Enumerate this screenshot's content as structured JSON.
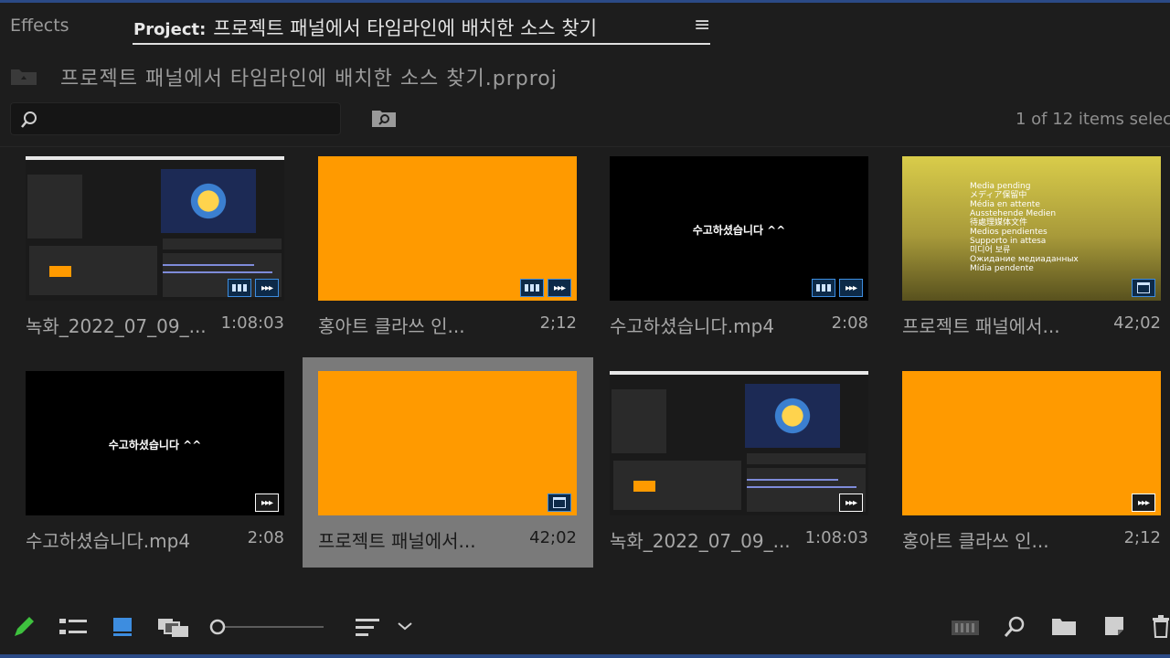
{
  "tabs": {
    "effects_label": "Effects",
    "project_label": "Project:",
    "project_title": "프로젝트 패널에서 타임라인에 배치한 소스 찾기",
    "menu_glyph": "≡"
  },
  "project": {
    "file_name": "프로젝트 패널에서 타임라인에 배치한 소스 찾기.prproj"
  },
  "search": {
    "value": "",
    "placeholder": ""
  },
  "selection_status": "1 of 12 items selec",
  "items": [
    {
      "name": "녹화_2022_07_09_...",
      "duration": "1:08:03",
      "thumb": "screen",
      "badges": [
        "video",
        "audio"
      ],
      "selected": false
    },
    {
      "name": "홍아트 클라쓰 인...",
      "duration": "2;12",
      "thumb": "orange",
      "badges": [
        "video",
        "audio"
      ],
      "selected": false
    },
    {
      "name": "수고하셨습니다.mp4",
      "duration": "2:08",
      "thumb": "black",
      "badges": [
        "video",
        "audio"
      ],
      "thumb_text": "수고하셨습니다 ^^",
      "selected": false
    },
    {
      "name": "프로젝트 패널에서...",
      "duration": "42;02",
      "thumb": "yellow",
      "badges": [
        "sequence"
      ],
      "selected": false,
      "pending_lines": [
        "Media pending",
        "メディア保留中",
        "Média en attente",
        "Ausstehende Medien",
        "待處理媒体文件",
        "Medios pendientes",
        "Supporto in attesa",
        "미디어 보류",
        "Ожидание медиаданных",
        "Mídia pendente"
      ]
    },
    {
      "name": "수고하셨습니다.mp4",
      "duration": "2:08",
      "thumb": "black",
      "badges": [
        "audio"
      ],
      "thumb_text": "수고하셨습니다 ^^",
      "selected": false
    },
    {
      "name": "프로젝트 패널에서...",
      "duration": "42;02",
      "thumb": "orange",
      "badges": [
        "sequence"
      ],
      "selected": true
    },
    {
      "name": "녹화_2022_07_09_...",
      "duration": "1:08:03",
      "thumb": "screen",
      "badges": [
        "audio"
      ],
      "selected": false
    },
    {
      "name": "홍아트 클라쓰 인...",
      "duration": "2;12",
      "thumb": "orange",
      "badges": [
        "audio"
      ],
      "selected": false
    }
  ],
  "colors": {
    "accent": "#2b4a86",
    "thumb_orange": "#ff9a00",
    "badge_blue": "#3d8de0",
    "selected_bg": "#7a7a7a"
  },
  "toolbar_icons": [
    "pencil-icon",
    "list-view-icon",
    "icon-view-icon",
    "freeform-view-icon",
    "zoom-slider",
    "sort-icon",
    "sort-dropdown-icon",
    "automate-icon",
    "find-icon",
    "new-bin-icon",
    "new-item-icon",
    "trash-icon"
  ]
}
